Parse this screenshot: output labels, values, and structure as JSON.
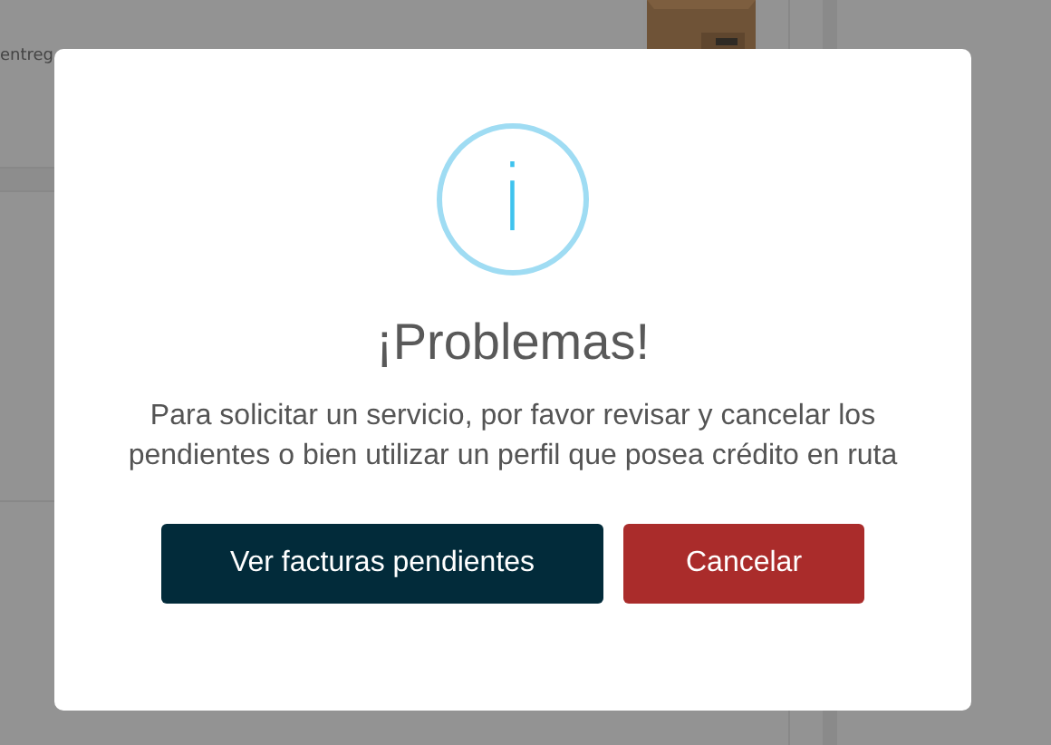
{
  "background": {
    "text_fragment": "entreg"
  },
  "dialog": {
    "icon_glyph": "i",
    "title": "¡Problemas!",
    "message": "Para solicitar un servicio, por favor revisar y cancelar los pendientes o bien utilizar un perfil que posea crédito en ruta",
    "buttons": [
      {
        "label": "Ver facturas pendientes",
        "kind": "primary"
      },
      {
        "label": "Cancelar",
        "kind": "danger"
      }
    ]
  }
}
